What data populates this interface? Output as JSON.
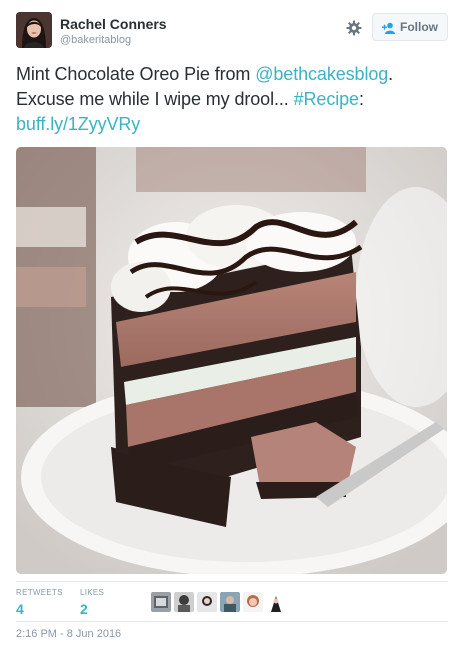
{
  "user": {
    "display_name": "Rachel Conners",
    "handle": "@bakeritablog"
  },
  "actions": {
    "follow_label": "Follow",
    "settings_icon": "gear-icon"
  },
  "tweet": {
    "text_1": "Mint Chocolate Oreo Pie from ",
    "mention": "@bethcakesblog",
    "text_2": ". Excuse me while I wipe my drool... ",
    "hashtag": "#Recipe",
    "text_3": ":",
    "link": "buff.ly/1ZyyVRy"
  },
  "stats": {
    "retweets_label": "RETWEETS",
    "retweets_value": "4",
    "likes_label": "LIKES",
    "likes_value": "2"
  },
  "timestamp": "2:16 PM - 8 Jun 2016",
  "colors": {
    "link": "#3bb3c3",
    "text": "#292f33",
    "muted": "#8899a6"
  }
}
